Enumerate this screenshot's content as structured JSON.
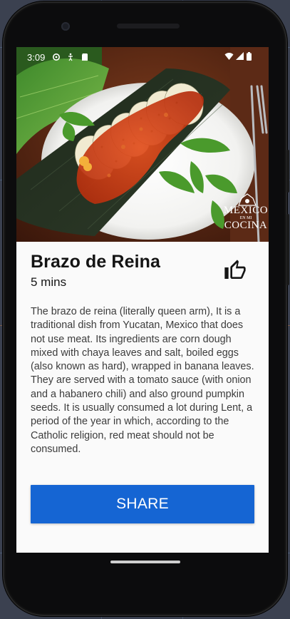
{
  "status_bar": {
    "time": "3:09",
    "icons": [
      "settings-icon",
      "accessibility-icon",
      "sd-card-icon",
      "wifi-icon",
      "signal-icon",
      "battery-icon"
    ]
  },
  "recipe": {
    "title": "Brazo de Reina",
    "duration": "5 mins",
    "description": "The brazo de reina (literally queen arm), It is a traditional dish from Yucatan, Mexico that does not use meat. Its ingredients are corn dough mixed with chaya leaves and salt, boiled eggs (also known as hard), wrapped in banana leaves. They are served with a tomato sauce (with onion and a habanero chili) and also ground pumpkin seeds. It is usually consumed a lot during Lent, a period of the year in which, according to the Catholic religion, red meat should not be consumed.",
    "watermark": {
      "line1": "MEXICO",
      "line2": "EN MI",
      "line3": "COCINA"
    }
  },
  "actions": {
    "like_icon": "thumbs-up-icon",
    "share_label": "SHARE"
  },
  "colors": {
    "accent": "#1565d3",
    "screen_bg": "#fafafa",
    "phone_frame": "#0c0c0d"
  }
}
